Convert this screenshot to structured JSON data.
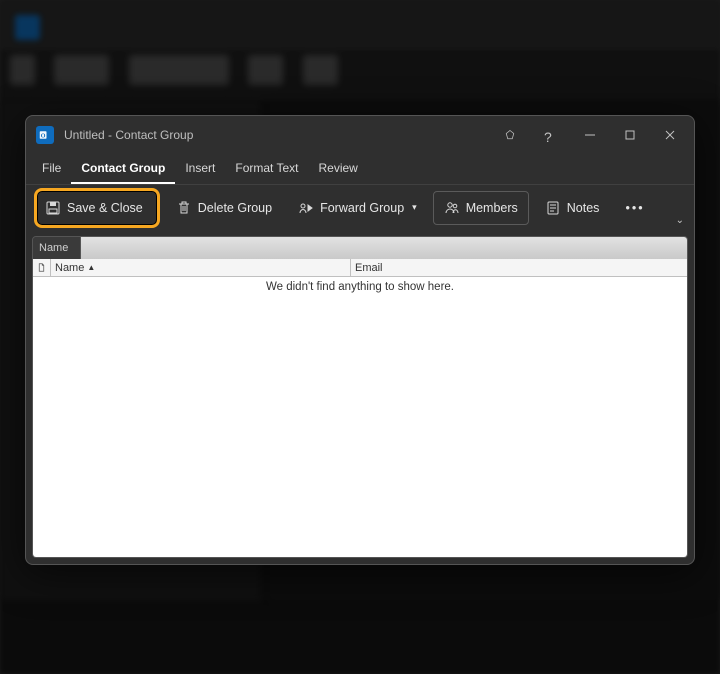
{
  "window": {
    "title": "Untitled  -  Contact Group"
  },
  "menubar": {
    "items": [
      {
        "label": "File",
        "active": false
      },
      {
        "label": "Contact Group",
        "active": true
      },
      {
        "label": "Insert",
        "active": false
      },
      {
        "label": "Format Text",
        "active": false
      },
      {
        "label": "Review",
        "active": false
      }
    ]
  },
  "ribbon": {
    "save_close": "Save & Close",
    "delete_group": "Delete Group",
    "forward_group": "Forward Group",
    "members": "Members",
    "notes": "Notes"
  },
  "content": {
    "name_label": "Name",
    "name_value": "",
    "columns": {
      "name": "Name",
      "email": "Email"
    },
    "empty_message": "We didn't find anything to show here."
  }
}
